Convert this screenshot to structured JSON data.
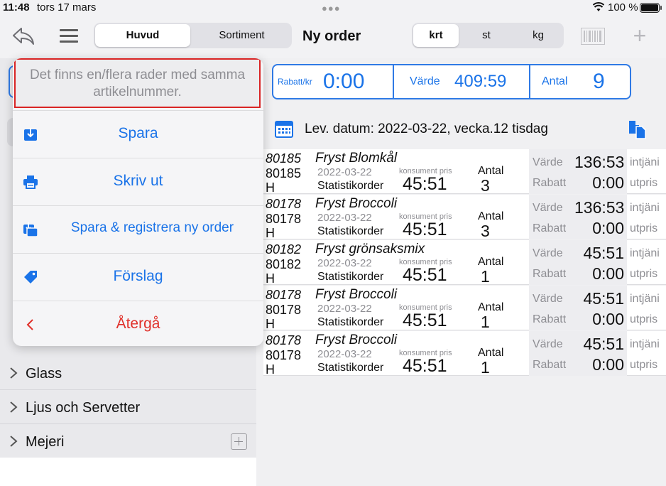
{
  "status_bar": {
    "time": "11:48",
    "date": "tors 17 mars",
    "battery": "100 %"
  },
  "nav": {
    "segments": [
      "Huvud",
      "Sortiment"
    ],
    "active_segment": "Huvud",
    "title": "Ny order",
    "units": [
      "krt",
      "st",
      "kg"
    ],
    "active_unit": "krt",
    "plus": "+"
  },
  "sidebar": {
    "items": [
      {
        "label": "Glass"
      },
      {
        "label": "Ljus och Servetter"
      },
      {
        "label": "Mejeri"
      }
    ]
  },
  "summary": {
    "rabatt_label": "Rabatt/kr",
    "rabatt_value": "0:00",
    "varde_label": "Värde",
    "varde_value": "409:59",
    "antal_label": "Antal",
    "antal_value": "9"
  },
  "delivery": {
    "text": "Lev. datum: 2022-03-22, vecka.12  tisdag"
  },
  "orders": [
    {
      "num_italic": "80185",
      "num": "80185",
      "unit": "H",
      "name": "Fryst Blomkål",
      "date": "2022-03-22",
      "type": "Statistikorder",
      "kp_label": "konsument pris",
      "kp_value": "45:51",
      "antal_label": "Antal",
      "antal": "3",
      "varde_label": "Värde",
      "varde": "136:53",
      "rabatt_label": "Rabatt",
      "rabatt": "0:00",
      "intj": "intjäni",
      "utpr": "utpris"
    },
    {
      "num_italic": "80178",
      "num": "80178",
      "unit": "H",
      "name": "Fryst Broccoli",
      "date": "2022-03-22",
      "type": "Statistikorder",
      "kp_label": "konsument pris",
      "kp_value": "45:51",
      "antal_label": "Antal",
      "antal": "3",
      "varde_label": "Värde",
      "varde": "136:53",
      "rabatt_label": "Rabatt",
      "rabatt": "0:00",
      "intj": "intjäni",
      "utpr": "utpris"
    },
    {
      "num_italic": "80182",
      "num": "80182",
      "unit": "H",
      "name": "Fryst grönsaksmix",
      "date": "2022-03-22",
      "type": "Statistikorder",
      "kp_label": "konsument pris",
      "kp_value": "45:51",
      "antal_label": "Antal",
      "antal": "1",
      "varde_label": "Värde",
      "varde": "45:51",
      "rabatt_label": "Rabatt",
      "rabatt": "0:00",
      "intj": "intjäni",
      "utpr": "utpris"
    },
    {
      "num_italic": "80178",
      "num": "80178",
      "unit": "H",
      "name": "Fryst Broccoli",
      "date": "2022-03-22",
      "type": "Statistikorder",
      "kp_label": "konsument pris",
      "kp_value": "45:51",
      "antal_label": "Antal",
      "antal": "1",
      "varde_label": "Värde",
      "varde": "45:51",
      "rabatt_label": "Rabatt",
      "rabatt": "0:00",
      "intj": "intjäni",
      "utpr": "utpris"
    },
    {
      "num_italic": "80178",
      "num": "80178",
      "unit": "H",
      "name": "Fryst Broccoli",
      "date": "2022-03-22",
      "type": "Statistikorder",
      "kp_label": "konsument pris",
      "kp_value": "45:51",
      "antal_label": "Antal",
      "antal": "1",
      "varde_label": "Värde",
      "varde": "45:51",
      "rabatt_label": "Rabatt",
      "rabatt": "0:00",
      "intj": "intjäni",
      "utpr": "utpris"
    }
  ],
  "popup": {
    "message": "Det finns en/flera rader med samma artikelnummer.",
    "items": [
      {
        "label": "Spara",
        "icon": "save-icon"
      },
      {
        "label": "Skriv ut",
        "icon": "print-icon"
      },
      {
        "label": "Spara & registrera ny order",
        "icon": "save-new-icon"
      },
      {
        "label": "Förslag",
        "icon": "tag-icon"
      },
      {
        "label": "Återgå",
        "icon": "chevron-left-icon"
      }
    ]
  },
  "colors": {
    "accent": "#1a73e8",
    "danger": "#e0302a",
    "highlight_border": "#d92424"
  }
}
